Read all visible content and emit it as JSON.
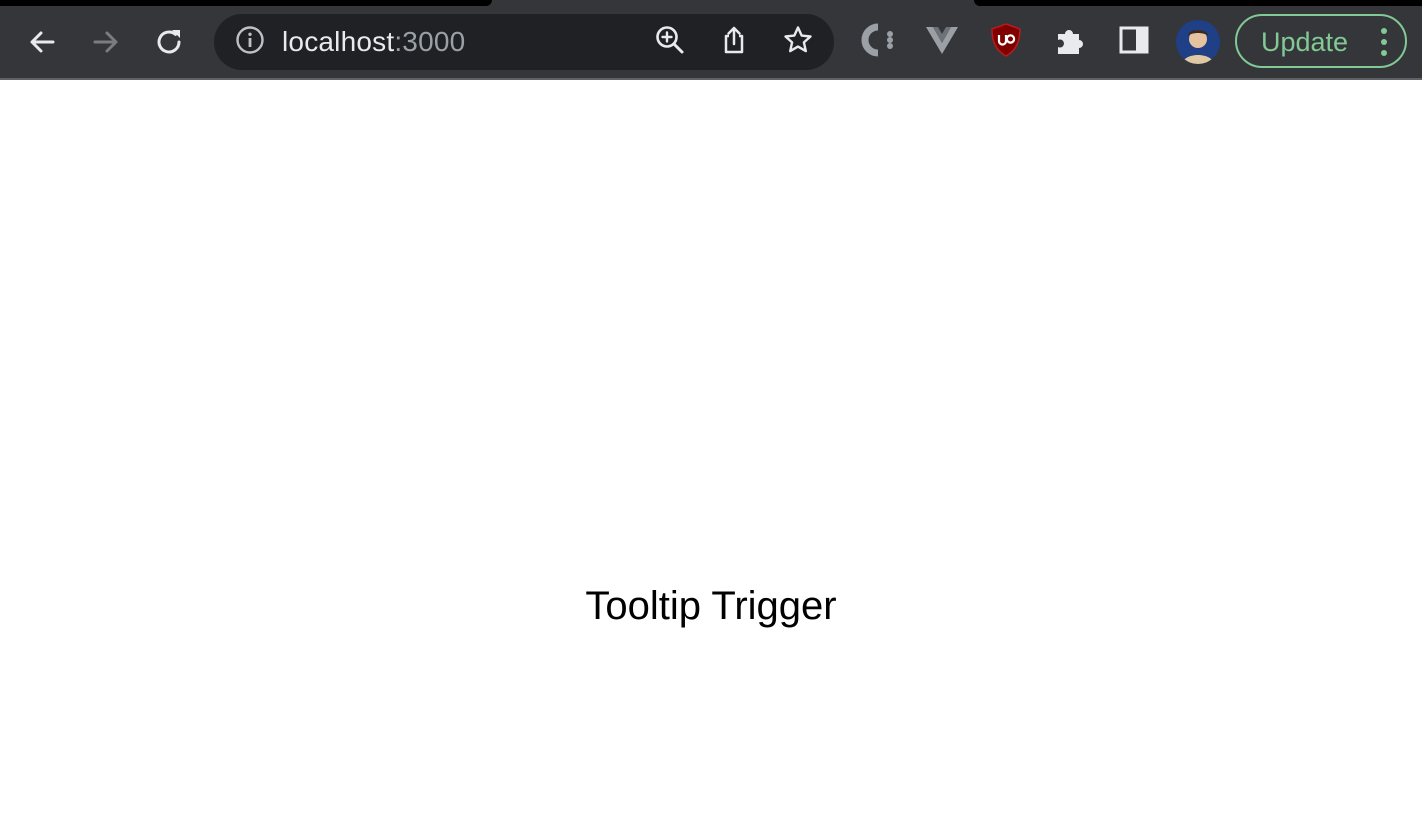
{
  "browser": {
    "address_bar": {
      "host": "localhost",
      "port": ":3000"
    },
    "update_button_label": "Update",
    "icons": {
      "back": "back-arrow-icon",
      "forward": "forward-arrow-icon",
      "reload": "reload-icon",
      "site_info": "info-icon",
      "zoom": "zoom-in-icon",
      "share": "share-icon",
      "bookmark": "star-icon",
      "extension_1": "colorzilla-extension-icon",
      "extension_2": "vue-devtools-icon",
      "extension_3": "ublock-origin-icon",
      "extensions_menu": "puzzle-piece-icon",
      "side_panel": "side-panel-icon",
      "profile": "profile-avatar",
      "menu": "kebab-menu-icon"
    },
    "colors": {
      "toolbar": "#35363a",
      "omnibox": "#202124",
      "update_accent": "#81c995",
      "ublock_red": "#800000"
    }
  },
  "page": {
    "tooltip_trigger": "Tooltip Trigger"
  }
}
